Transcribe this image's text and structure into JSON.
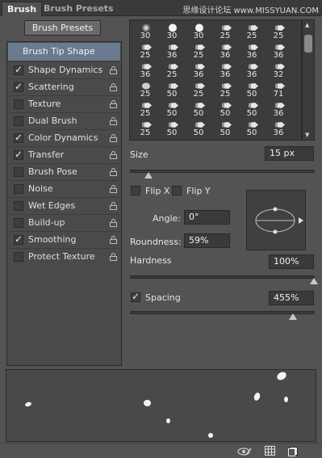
{
  "tabs": {
    "brush": "Brush",
    "brush_presets": "Brush Presets"
  },
  "watermark": "思缘设计论坛 www.MISSYUAN.COM",
  "brush_presets_button": "Brush Presets",
  "options": {
    "header": "Brush Tip Shape",
    "items": [
      {
        "label": "Shape Dynamics",
        "checked": true
      },
      {
        "label": "Scattering",
        "checked": true
      },
      {
        "label": "Texture",
        "checked": false
      },
      {
        "label": "Dual Brush",
        "checked": false
      },
      {
        "label": "Color Dynamics",
        "checked": true
      },
      {
        "label": "Transfer",
        "checked": true
      },
      {
        "label": "Brush Pose",
        "checked": false
      },
      {
        "label": "Noise",
        "checked": false
      },
      {
        "label": "Wet Edges",
        "checked": false
      },
      {
        "label": "Build-up",
        "checked": false
      },
      {
        "label": "Smoothing",
        "checked": true
      },
      {
        "label": "Protect Texture",
        "checked": false
      }
    ]
  },
  "brush_grid": {
    "rows": [
      [
        "30",
        "30",
        "30",
        "25",
        "25",
        "25"
      ],
      [
        "25",
        "36",
        "25",
        "36",
        "36",
        "36"
      ],
      [
        "36",
        "25",
        "36",
        "36",
        "36",
        "32"
      ],
      [
        "25",
        "50",
        "25",
        "25",
        "50",
        "71"
      ],
      [
        "25",
        "50",
        "50",
        "50",
        "50",
        "36"
      ],
      [
        "25",
        "50",
        "50",
        "50",
        "50",
        "36"
      ]
    ],
    "tips": [
      [
        "soft-round",
        "hard-round",
        "hard-round",
        "chalk",
        "chalk",
        "chalk"
      ],
      [
        "chalk",
        "chalk",
        "chalk",
        "chalk",
        "chalk",
        "chalk"
      ],
      [
        "chalk",
        "chalk",
        "chalk",
        "chalk",
        "chalk",
        "chalk"
      ],
      [
        "round-soft",
        "chalk",
        "chalk",
        "chalk",
        "chalk",
        "chalk"
      ],
      [
        "chalk",
        "chalk",
        "chalk",
        "chalk",
        "chalk",
        "chalk"
      ],
      [
        "chalk",
        "chalk",
        "chalk",
        "chalk",
        "chalk",
        "chalk"
      ]
    ]
  },
  "size": {
    "label": "Size",
    "value": "15 px",
    "slider_fraction": 0.1
  },
  "flip_x": {
    "label": "Flip X",
    "checked": false
  },
  "flip_y": {
    "label": "Flip Y",
    "checked": false
  },
  "angle": {
    "label": "Angle:",
    "value": "0°"
  },
  "roundness": {
    "label": "Roundness:",
    "value": "59%"
  },
  "hardness": {
    "label": "Hardness",
    "value": "100%",
    "slider_fraction": 1.0
  },
  "spacing": {
    "label": "Spacing",
    "value": "455%",
    "checked": true,
    "slider_fraction": 0.88
  },
  "colors": {
    "panel": "#535353",
    "selected": "#6a7a90",
    "field": "#3a3a3a"
  },
  "icons": {
    "toggle_preview": "eye-brush-icon",
    "grid": "grid-icon",
    "new": "new-preset-icon",
    "menu": "panel-menu-icon",
    "lock": "lock-icon"
  }
}
